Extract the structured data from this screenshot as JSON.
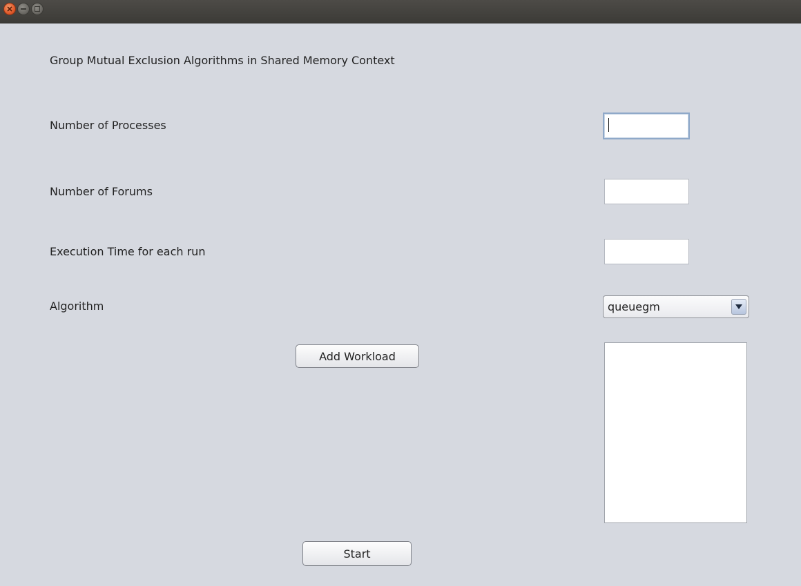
{
  "window": {
    "controls": {
      "close_icon": "close-icon",
      "minimize_icon": "minimize-icon",
      "maximize_icon": "maximize-icon"
    }
  },
  "heading": "Group Mutual Exclusion Algorithms in Shared Memory Context",
  "form": {
    "processes_label": "Number of Processes",
    "processes_value": "",
    "forums_label": "Number of Forums",
    "forums_value": "",
    "execution_time_label": "Execution Time for each run",
    "execution_time_value": "",
    "algorithm_label": "Algorithm",
    "algorithm_selected": "queuegm"
  },
  "buttons": {
    "add_workload": "Add Workload",
    "start": "Start"
  },
  "workload_list": {
    "items": []
  },
  "colors": {
    "window_background": "#d6d9e0",
    "titlebar": "#3c3b37",
    "close_button": "#e0592a"
  }
}
